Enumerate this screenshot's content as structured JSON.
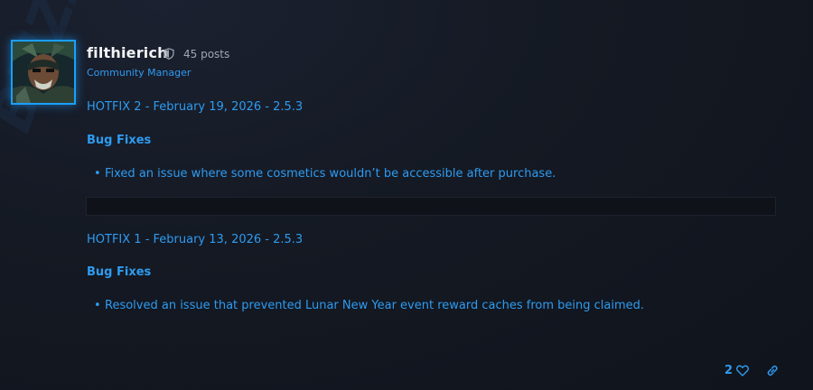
{
  "author": {
    "username": "filthierich",
    "post_count": "45 posts",
    "title": "Community Manager",
    "avatar_icon": "avatar-image",
    "badge_icon": "shield-icon"
  },
  "post": {
    "hotfixes": [
      {
        "heading": "HOTFIX 2 - February 19, 2026 - 2.5.3",
        "section": "Bug Fixes",
        "items": [
          "Fixed an issue where some cosmetics wouldn’t be accessible after purchase."
        ]
      },
      {
        "heading": "HOTFIX 1 - February 13, 2026 - 2.5.3",
        "section": "Bug Fixes",
        "items": [
          "Resolved an issue that prevented Lunar New Year event reward caches from being claimed."
        ]
      }
    ]
  },
  "actions": {
    "like_count": "2",
    "like_icon": "heart-icon",
    "share_icon": "link-icon"
  },
  "colors": {
    "accent": "#2e9bf0",
    "avatar_border": "#1a9fff",
    "background": "#141923"
  },
  "watermark": {
    "text": "BLIZZARD"
  }
}
